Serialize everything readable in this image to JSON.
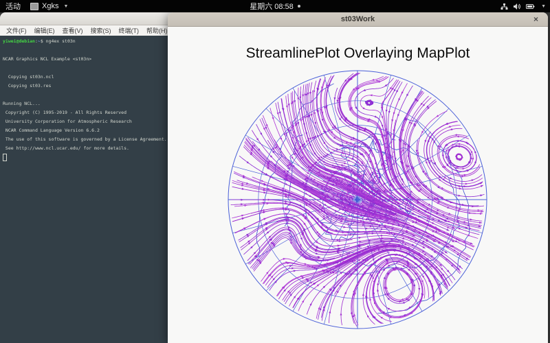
{
  "topbar": {
    "activities": "活动",
    "app_name": "Xgks",
    "clock": "星期六 08:58"
  },
  "terminal": {
    "menu": [
      "文件(F)",
      "编辑(E)",
      "查看(V)",
      "搜索(S)",
      "终端(T)",
      "帮助(H)"
    ],
    "prompt": {
      "user_host": "yiwei@debian",
      "separator": ":",
      "path": "~",
      "symbol": "$ ",
      "command": "ng4ex st03n"
    },
    "lines": [
      "",
      "NCAR Graphics NCL Example <st03n>",
      "",
      "  Copying st03n.ncl",
      "  Copying st03.res",
      "",
      "Running NCL...",
      " Copyright (C) 1995-2019 - All Rights Reserved",
      " University Corporation for Atmospheric Research",
      " NCAR Command Language Version 6.6.2",
      " The use of this software is governed by a License Agreement.",
      " See http://www.ncl.ucar.edu/ for more details."
    ]
  },
  "plot_window": {
    "title": "st03Work",
    "close_label": "×",
    "figure_title": "StreamlinePlot Overlaying MapPlot",
    "colors": {
      "grid": "#4a5fd8",
      "coast": "#3a4fd0",
      "streamlines": [
        "#a233d2",
        "#9a2bd0",
        "#ae3ad6",
        "#8f30d4"
      ],
      "background": "#f8f8f7"
    }
  }
}
